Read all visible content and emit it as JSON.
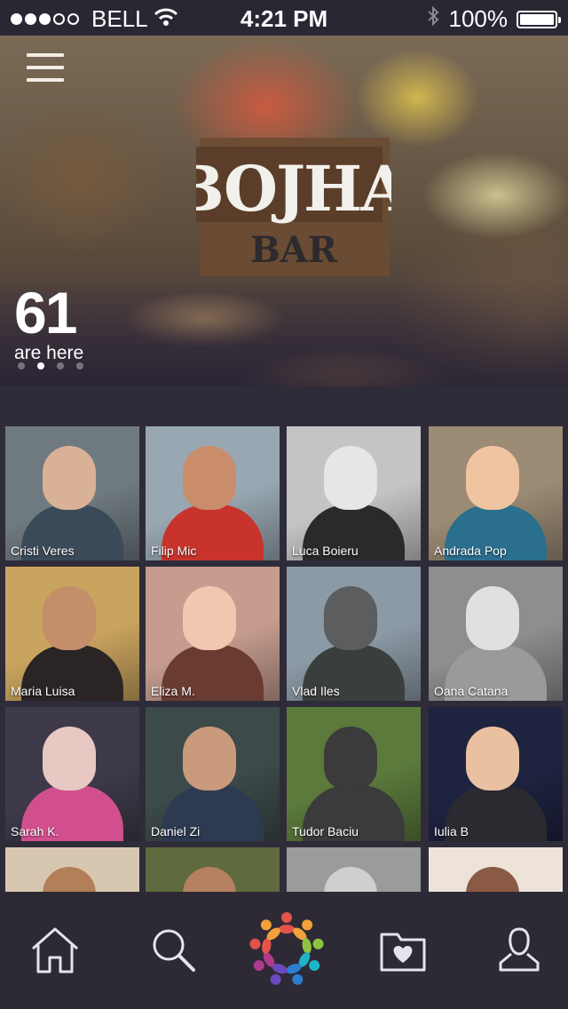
{
  "status_bar": {
    "carrier": "BELL",
    "time": "4:21 PM",
    "battery": "100%",
    "signal_bars_filled": 3,
    "signal_bars_total": 5,
    "icons": [
      "signal-dots-icon",
      "wifi-icon",
      "bluetooth-icon",
      "battery-icon"
    ]
  },
  "venue": {
    "logo_text": "BOJHA BAR",
    "people_count": "61",
    "people_label": "are here",
    "carousel_pages": 4,
    "carousel_active_index": 1
  },
  "people": [
    {
      "name": "Cristi Veres",
      "bg": "#6f7a80",
      "skin": "#d8b196",
      "shirt": "#3b4a58"
    },
    {
      "name": "Filip Mic",
      "bg": "#98a7b2",
      "skin": "#c98d6c",
      "shirt": "#c8342c"
    },
    {
      "name": "Luca Boieru",
      "bg": "#c4c4c4",
      "skin": "#e6e6e6",
      "shirt": "#2a2a2a"
    },
    {
      "name": "Andrada Pop",
      "bg": "#9b8a74",
      "skin": "#efc4a0",
      "shirt": "#2b6f8f"
    },
    {
      "name": "Maria Luisa",
      "bg": "#c9a45e",
      "skin": "#c48e6a",
      "shirt": "#2a2424"
    },
    {
      "name": "Eliza M.",
      "bg": "#c59c8e",
      "skin": "#f0c8b0",
      "shirt": "#6a3b30"
    },
    {
      "name": "Vlad Iles",
      "bg": "#8c9aa6",
      "skin": "#5b5d5e",
      "shirt": "#3b3f3c"
    },
    {
      "name": "Oana Catana",
      "bg": "#8e8e8e",
      "skin": "#e0e0e0",
      "shirt": "#9a9a9a"
    },
    {
      "name": "Sarah K.",
      "bg": "#3f3a4a",
      "skin": "#e8c8c2",
      "shirt": "#d24f8e"
    },
    {
      "name": "Daniel Zi",
      "bg": "#3d4a4a",
      "skin": "#c99a7c",
      "shirt": "#2d3a50"
    },
    {
      "name": "Tudor Baciu",
      "bg": "#5b7a3c",
      "skin": "#3b3b3b",
      "shirt": "#3b3b3b"
    },
    {
      "name": "Iulia B",
      "bg": "#1e2340",
      "skin": "#e9c0a0",
      "shirt": "#2a2a30"
    },
    {
      "name": "",
      "bg": "#d8c7b0",
      "skin": "#b37f58",
      "shirt": "#6a4b3b"
    },
    {
      "name": "",
      "bg": "#5f6a3e",
      "skin": "#b48060",
      "shirt": "#3a2a25"
    },
    {
      "name": "",
      "bg": "#9b9b9b",
      "skin": "#cfcfcf",
      "shirt": "#2a2a2a"
    },
    {
      "name": "",
      "bg": "#ede3d8",
      "skin": "#8a5a44",
      "shirt": "#8a5a44"
    }
  ],
  "tabs": [
    {
      "name": "home",
      "icon": "home-icon"
    },
    {
      "name": "search",
      "icon": "search-icon"
    },
    {
      "name": "check-in",
      "icon": "people-circle-icon"
    },
    {
      "name": "favorites",
      "icon": "heart-folder-icon"
    },
    {
      "name": "profile",
      "icon": "user-icon"
    }
  ],
  "colors": {
    "background": "#2f2c3a",
    "tabbar": "#2d2a36",
    "icon_stroke": "#e6e2ee",
    "brand_ring": [
      "#e3534a",
      "#f3a13b",
      "#8cc43f",
      "#1fb3c9",
      "#2c7ed0",
      "#6a4ac0",
      "#b03a8c"
    ]
  }
}
